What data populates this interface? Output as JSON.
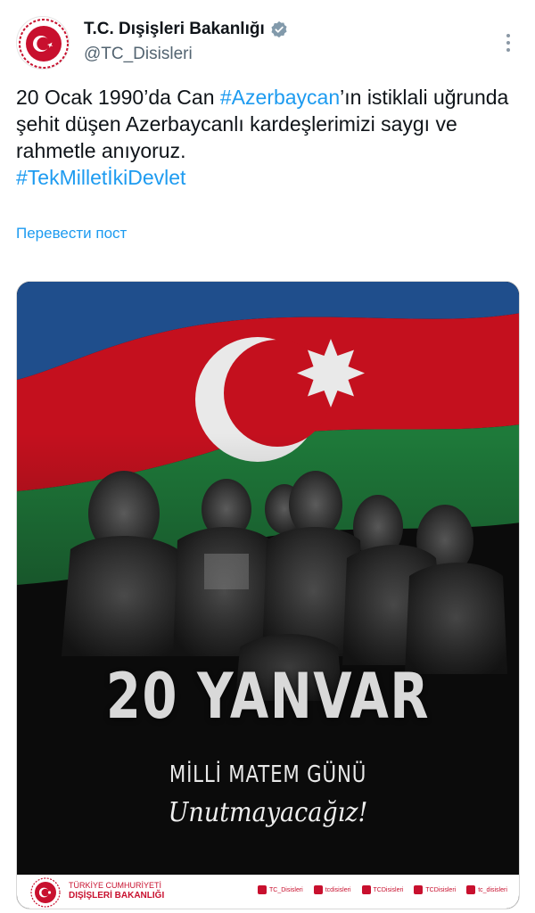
{
  "account": {
    "display_name": "T.C. Dışişleri Bakanlığı",
    "handle": "@TC_Disisleri",
    "avatar_icon": "turkish-ministry-seal-icon",
    "verified_icon": "verified-badge-icon",
    "more_icon": "more-vertical-icon"
  },
  "tweet": {
    "text_part1": "20 Ocak 1990’da Can ",
    "hashtag1": "#Azerbaycan",
    "text_part2": "’ın istiklali uğrunda şehit düşen Azerbaycanlı kardeşlerimizi saygı ve rahmetle anıyoruz.",
    "hashtag2": "#TekMilletİkiDevlet",
    "translate_label": "Перевести пост"
  },
  "poster": {
    "title": "20 YANVAR",
    "subtitle": "MİLLİ MATEM GÜNÜ",
    "slogan": "Unutmayacağız!",
    "footer_org_line1": "TÜRKİYE CUMHURİYETİ",
    "footer_org_line2": "DIŞİŞLERİ BAKANLIĞI",
    "socials": [
      {
        "icon": "x-icon",
        "label": "TC_Disisleri"
      },
      {
        "icon": "instagram-icon",
        "label": "tcdisisleri"
      },
      {
        "icon": "facebook-icon",
        "label": "TCDisisleri"
      },
      {
        "icon": "youtube-icon",
        "label": "TCDisisleri"
      },
      {
        "icon": "news-icon",
        "label": "tc_disisleri"
      }
    ]
  },
  "colors": {
    "link": "#1d9bf0",
    "flag_blue": "#1f4e8c",
    "flag_red": "#c4101e",
    "flag_green": "#1e7a3a",
    "brand_red": "#c8102e"
  }
}
